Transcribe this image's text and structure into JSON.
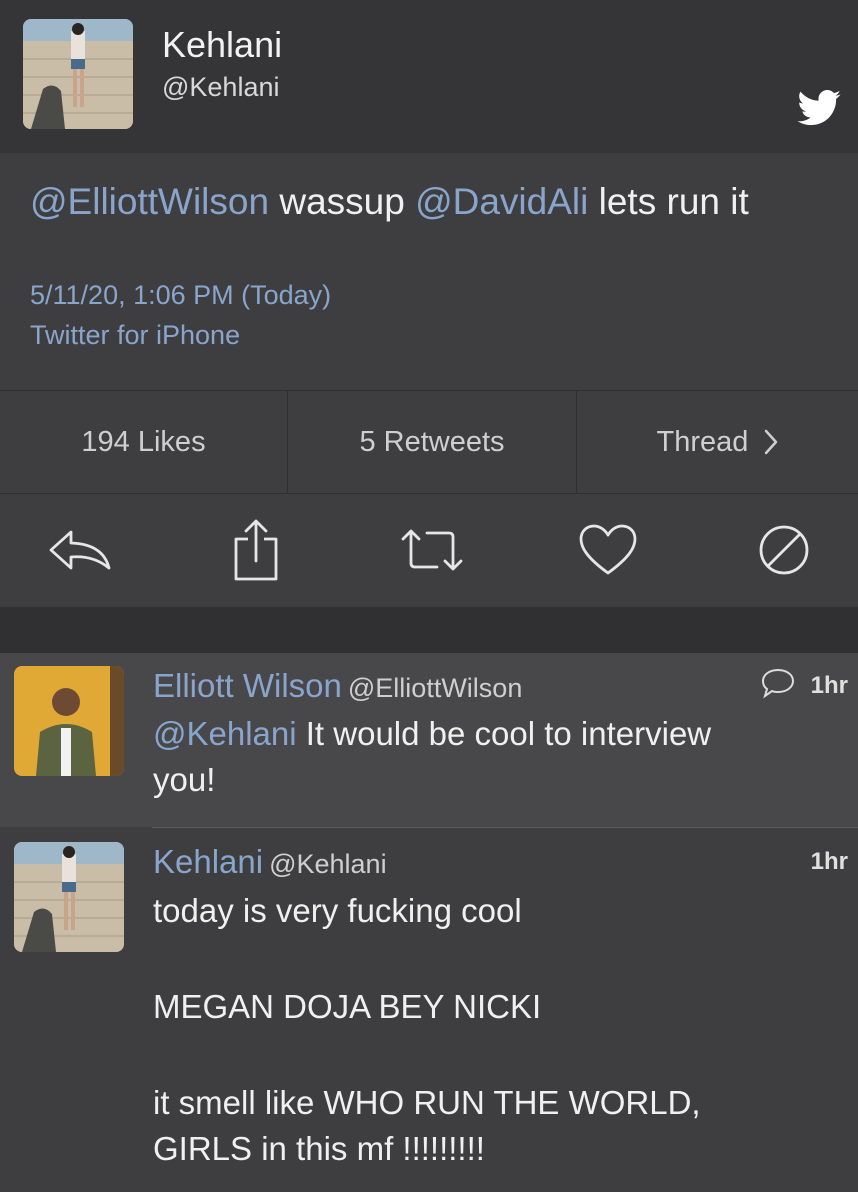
{
  "header": {
    "name": "Kehlani",
    "handle": "@Kehlani",
    "logo_icon": "twitter-bird-icon"
  },
  "tweet": {
    "mention1": "@ElliottWilson",
    "text1": " wassup ",
    "mention2": "@DavidAli",
    "text2": " lets run it",
    "date": "5/11/20, 1:06 PM (Today)",
    "source": "Twitter for iPhone"
  },
  "stats": {
    "likes": "194 Likes",
    "retweets": "5 Retweets",
    "thread": "Thread"
  },
  "actions": [
    "reply-icon",
    "share-icon",
    "retweet-icon",
    "like-icon",
    "block-icon"
  ],
  "replies": [
    {
      "name": "Elliott Wilson",
      "handle": "@ElliottWilson",
      "time": "1hr",
      "mention": "@Kehlani",
      "text_line1": " It would be cool to interview",
      "text_line2": "you!"
    },
    {
      "name": "Kehlani",
      "handle": "@Kehlani",
      "time": "1hr",
      "line1": "today is very fucking cool",
      "line2": "MEGAN DOJA BEY NICKI",
      "line3": "it smell like WHO RUN THE WORLD,",
      "line4": "GIRLS in this mf !!!!!!!!!"
    }
  ],
  "colors": {
    "accent": "#8aa5cc",
    "background": "#3e3e40",
    "header": "#353537"
  }
}
